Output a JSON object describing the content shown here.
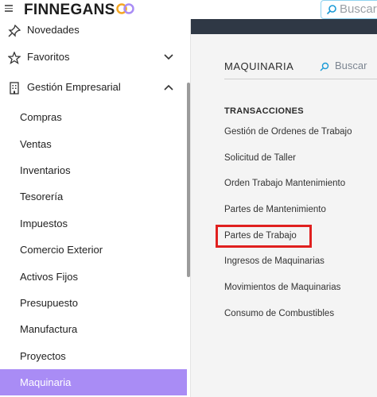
{
  "header": {
    "brand": "FINNEGANS",
    "search_placeholder": "Buscar..."
  },
  "sidebar": {
    "top_items": [
      {
        "label": "Novedades",
        "icon": "pin-icon"
      },
      {
        "label": "Favoritos",
        "icon": "star-icon"
      },
      {
        "label": "Gestión Empresarial",
        "icon": "building-icon"
      }
    ],
    "sub_items": [
      "Compras",
      "Ventas",
      "Inventarios",
      "Tesorería",
      "Impuestos",
      "Comercio Exterior",
      "Activos Fijos",
      "Presupuesto",
      "Manufactura",
      "Proyectos",
      "Maquinaria"
    ],
    "active_item": "Maquinaria"
  },
  "main": {
    "module_title": "MAQUINARIA",
    "search_label": "Buscar",
    "section_title": "TRANSACCIONES",
    "links": [
      "Gestión de Ordenes de Trabajo",
      "Solicitud de Taller",
      "Orden Trabajo Mantenimiento",
      "Partes de Mantenimiento",
      "Partes de Trabajo",
      "Ingresos de Maquinarias",
      "Movimientos de Maquinarias",
      "Consumo de Combustibles"
    ],
    "highlighted_link": "Partes de Trabajo"
  },
  "colors": {
    "active_bg": "#a98cf5",
    "highlight_border": "#e0201f",
    "topstrip": "#2f3845",
    "logo_orange": "#f5a623",
    "logo_purple": "#a98cf5"
  }
}
